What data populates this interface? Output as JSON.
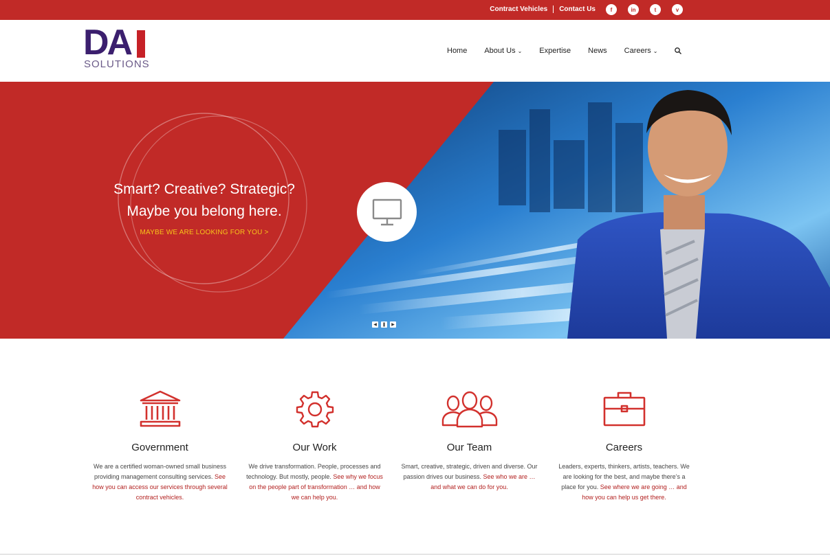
{
  "topbar": {
    "contract_vehicles": "Contract Vehicles",
    "contact_us": "Contact Us",
    "social": [
      "f",
      "in",
      "t",
      "v"
    ],
    "bg_color": "#c12a27"
  },
  "logo": {
    "mark": "DA",
    "sub": "SOLUTIONS"
  },
  "nav": {
    "home": "Home",
    "about": "About Us",
    "expertise": "Expertise",
    "news": "News",
    "careers": "Careers"
  },
  "hero": {
    "line1": "Smart? Creative? Strategic?",
    "line2": "Maybe you belong here.",
    "cta": "MAYBE WE ARE LOOKING FOR YOU >",
    "accent": "#f7c31a"
  },
  "features": [
    {
      "title": "Government",
      "text": "We are a certified woman-owned small business providing management consulting services. ",
      "link": "See how you can access our services through several contract vehicles."
    },
    {
      "title": "Our Work",
      "text": "We drive transformation. People, processes and technology. But mostly, people. ",
      "link": "See why we focus on the people part of transformation … and how we can help you."
    },
    {
      "title": "Our Team",
      "text": "Smart, creative, strategic, driven and diverse. Our passion drives our business. ",
      "link": "See who we are … and what we can do for you."
    },
    {
      "title": "Careers",
      "text": "Leaders, experts, thinkers, artists, teachers. We are looking for the best, and maybe there’s a place for you. ",
      "link": "See where we are going … and how you can help us get there."
    }
  ]
}
